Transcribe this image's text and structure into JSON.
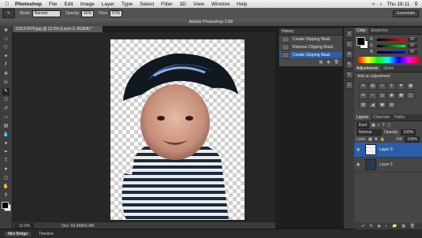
{
  "menubar": {
    "apple": "",
    "app": "Photoshop",
    "items": [
      "File",
      "Edit",
      "Image",
      "Layer",
      "Type",
      "Select",
      "Filter",
      "3D",
      "View",
      "Window",
      "Help"
    ],
    "clock": "Thu 16:11"
  },
  "options": {
    "mode_label": "Mode:",
    "mode_value": "Normal",
    "opacity_label": "Opacity:",
    "opacity_value": "55%",
    "flow_label": "Flow:",
    "flow_value": "57%",
    "workspace": "Essentials"
  },
  "window": {
    "title": "Adobe Photoshop CS6"
  },
  "document": {
    "tab": "DSCF2076.jpg @ 12.5% (Layer 3, RGB/8) *",
    "zoom": "12.5%",
    "doc_info": "Doc: 69.4M/54.4M"
  },
  "history": {
    "title": "History",
    "items": [
      {
        "label": "Create Clipping Mask",
        "selected": false
      },
      {
        "label": "Release Clipping Mask",
        "selected": false
      },
      {
        "label": "Create Clipping Mask",
        "selected": true
      }
    ]
  },
  "color_panel": {
    "tabs": [
      "Color",
      "Swatches"
    ],
    "r": "87",
    "g": "87",
    "b": "87"
  },
  "adjustments": {
    "tabs": [
      "Adjustments",
      "Styles"
    ],
    "hint": "Add an adjustment"
  },
  "layers": {
    "tabs": [
      "Layers",
      "Channels",
      "Paths"
    ],
    "kind": "Kind",
    "blend": "Normal",
    "opacity_label": "Opacity:",
    "opacity_value": "100%",
    "lock_label": "Lock:",
    "fill_label": "Fill:",
    "fill_value": "100%",
    "rows": [
      {
        "name": "Layer 3",
        "selected": true
      },
      {
        "name": "Layer 2",
        "selected": false
      }
    ]
  },
  "bottom_tabs": [
    "Mini Bridge",
    "Timeline"
  ],
  "colors": {
    "accent": "#2a5ea8",
    "panel": "#464646",
    "workspace": "#262626"
  }
}
